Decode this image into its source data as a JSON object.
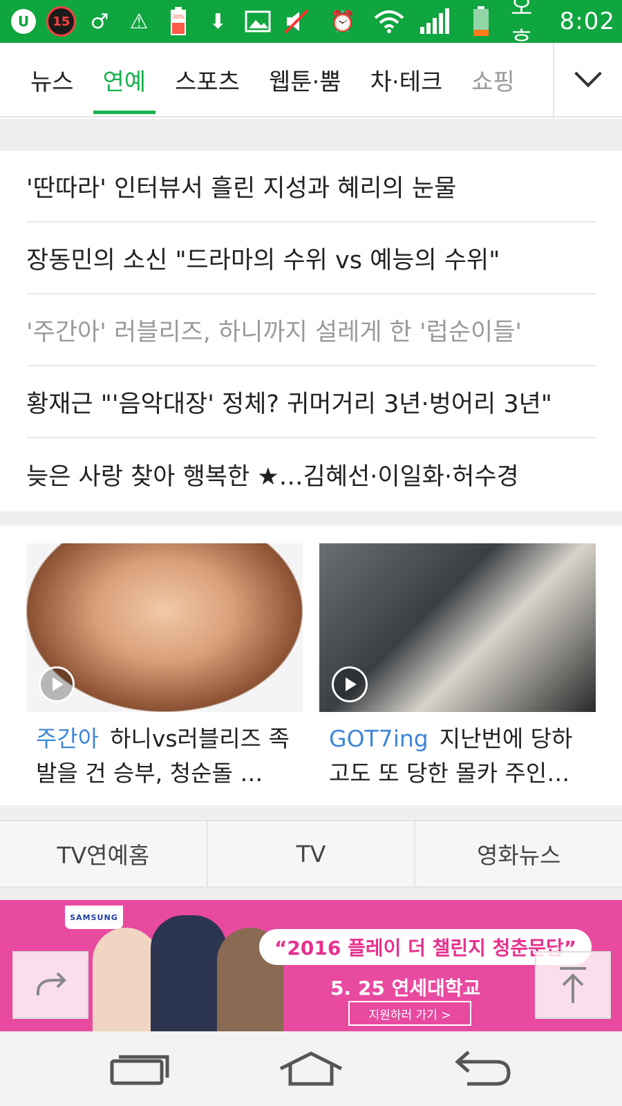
{
  "status_bar": {
    "notification_count": "15",
    "battery_small_label": "30%",
    "time_period": "오후",
    "time": "8:02"
  },
  "tabs": [
    {
      "label": "뉴스",
      "active": false
    },
    {
      "label": "연예",
      "active": true
    },
    {
      "label": "스포츠",
      "active": false
    },
    {
      "label": "웹툰·뿜",
      "active": false
    },
    {
      "label": "차·테크",
      "active": false
    },
    {
      "label": "쇼핑",
      "active": false
    }
  ],
  "headlines": [
    {
      "text": "'딴따라' 인터뷰서 흘린 지성과 혜리의 눈물",
      "visited": false
    },
    {
      "text": "장동민의 소신 \"드라마의 수위 vs 예능의 수위\"",
      "visited": false
    },
    {
      "text": "'주간아' 러블리즈, 하니까지 설레게 한 '럽순이들'",
      "visited": true
    },
    {
      "text": "황재근 \"'음악대장' 정체? 귀머거리 3년·벙어리 3년\"",
      "visited": false
    },
    {
      "text": "늦은 사랑 찾아 행복한 ★…김혜선·이일화·허수경",
      "visited": false
    }
  ],
  "cards": [
    {
      "tag": "주간아",
      "text": "하니vs러블리즈 족발을 건 승부, 청순돌 …"
    },
    {
      "tag": "GOT7ing",
      "text": "지난번에 당하고도 또 당한 몰카 주인…"
    }
  ],
  "links": [
    "TV연예홈",
    "TV",
    "영화뉴스"
  ],
  "ad": {
    "brand": "SAMSUNG",
    "title": "“2016 플레이 더 챌린지 청춘문답”",
    "subtitle": "5. 25 연세대학교",
    "cta": "지원하러 가기 >"
  },
  "colors": {
    "status_green": "#0fa53f",
    "active_tab": "#18b04d",
    "tag_blue": "#3d86d8",
    "ad_pink": "#e84aa0"
  }
}
